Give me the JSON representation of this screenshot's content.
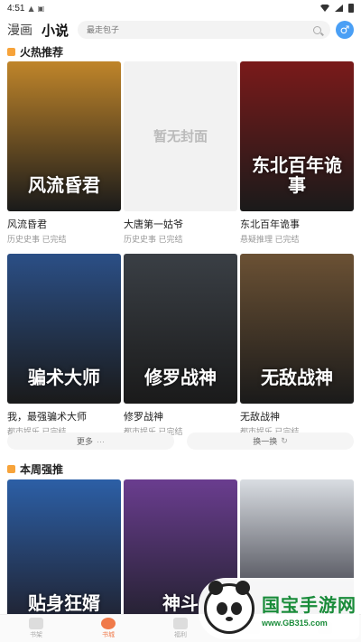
{
  "status": {
    "time": "4:51"
  },
  "header": {
    "tabs": [
      {
        "label": "漫画"
      },
      {
        "label": "小说"
      }
    ],
    "search_placeholder": "最走包子"
  },
  "sections": {
    "hot": {
      "title": "火热推荐"
    },
    "weekly": {
      "title": "本周强推"
    }
  },
  "hot_books": [
    {
      "name": "风流昏君",
      "meta": "历史史事 已完结",
      "cover_text": "风流昏君",
      "cover_color": "#c0852a"
    },
    {
      "name": "大唐第一姑爷",
      "meta": "历史史事 已完结",
      "cover_text": "暂无封面",
      "cover_color": "#f2f2f2"
    },
    {
      "name": "东北百年诡事",
      "meta": "悬疑推理 已完结",
      "cover_text": "东北百年诡事",
      "cover_color": "#7a1a1a"
    },
    {
      "name": "我，最强骗术大师",
      "meta": "都市娱乐 已完结",
      "cover_text": "骗术大师",
      "cover_color": "#2b4f86"
    },
    {
      "name": "修罗战神",
      "meta": "都市娱乐 已完结",
      "cover_text": "修罗战神",
      "cover_color": "#3a3f45"
    },
    {
      "name": "无敌战神",
      "meta": "都市娱乐 已完结",
      "cover_text": "无敌战神",
      "cover_color": "#6b5134"
    }
  ],
  "actions": {
    "more": "更多",
    "refresh": "换一换"
  },
  "weekly_books": [
    {
      "cover_text": "贴身狂婿",
      "cover_color": "#2c5fa6"
    },
    {
      "cover_text": "神斗",
      "cover_color": "#6a3d8f"
    },
    {
      "cover_text": "",
      "cover_color": "#d9dde2"
    }
  ],
  "bottom_nav": [
    {
      "label": "书架"
    },
    {
      "label": "书城"
    },
    {
      "label": "福利"
    },
    {
      "label": ""
    },
    {
      "label": ""
    }
  ],
  "watermark": {
    "title": "国宝手游网",
    "url": "www.GB315.com"
  }
}
